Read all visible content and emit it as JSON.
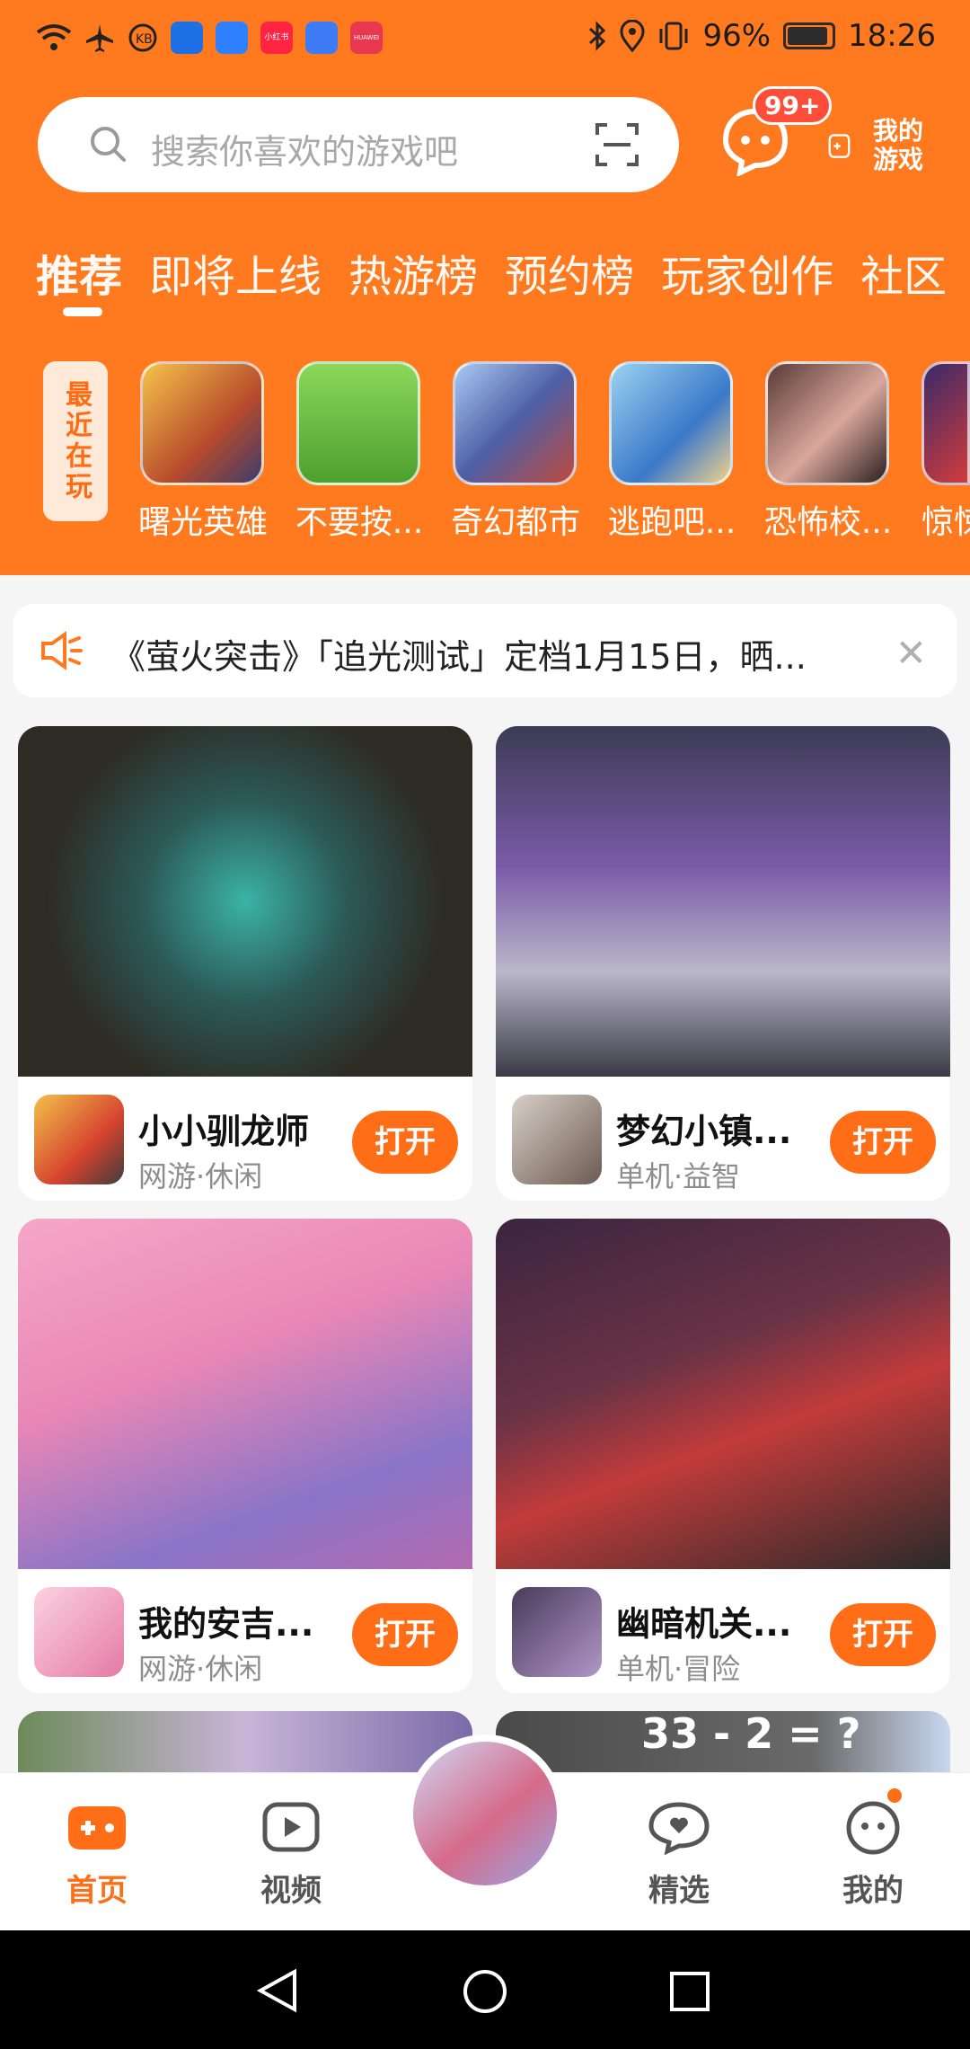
{
  "status_bar": {
    "battery": "96%",
    "time": "18:26",
    "app_badge_xhs": "小红书",
    "app_badge_huawei": "HUAWEI"
  },
  "search": {
    "placeholder": "搜索你喜欢的游戏吧"
  },
  "header": {
    "message_badge": "99+",
    "my_games_line1": "我的",
    "my_games_line2": "游戏"
  },
  "tabs": [
    "推荐",
    "即将上线",
    "热游榜",
    "预约榜",
    "玩家创作",
    "社区"
  ],
  "recent": {
    "label": "最近在玩",
    "items": [
      "曙光英雄",
      "不要按...",
      "奇幻都市",
      "逃跑吧...",
      "恐怖校...",
      "惊悚"
    ]
  },
  "notice": {
    "text": "《萤火突击》「追光测试」定档1月15日，晒...",
    "close": "✕"
  },
  "cards": [
    {
      "title": "小小驯龙师",
      "tags": "网游·休闲",
      "button": "打开"
    },
    {
      "title": "梦幻小镇...",
      "tags": "单机·益智",
      "button": "打开"
    },
    {
      "title": "我的安吉...",
      "tags": "网游·休闲",
      "button": "打开"
    },
    {
      "title": "幽暗机关...",
      "tags": "单机·冒险",
      "button": "打开"
    }
  ],
  "peek": {
    "math": "33 - 2 = ?"
  },
  "nav": {
    "home": "首页",
    "video": "视频",
    "featured": "精选",
    "mine": "我的"
  },
  "colors": {
    "brand": "#ff7a1f",
    "button": "#ff6d17"
  }
}
